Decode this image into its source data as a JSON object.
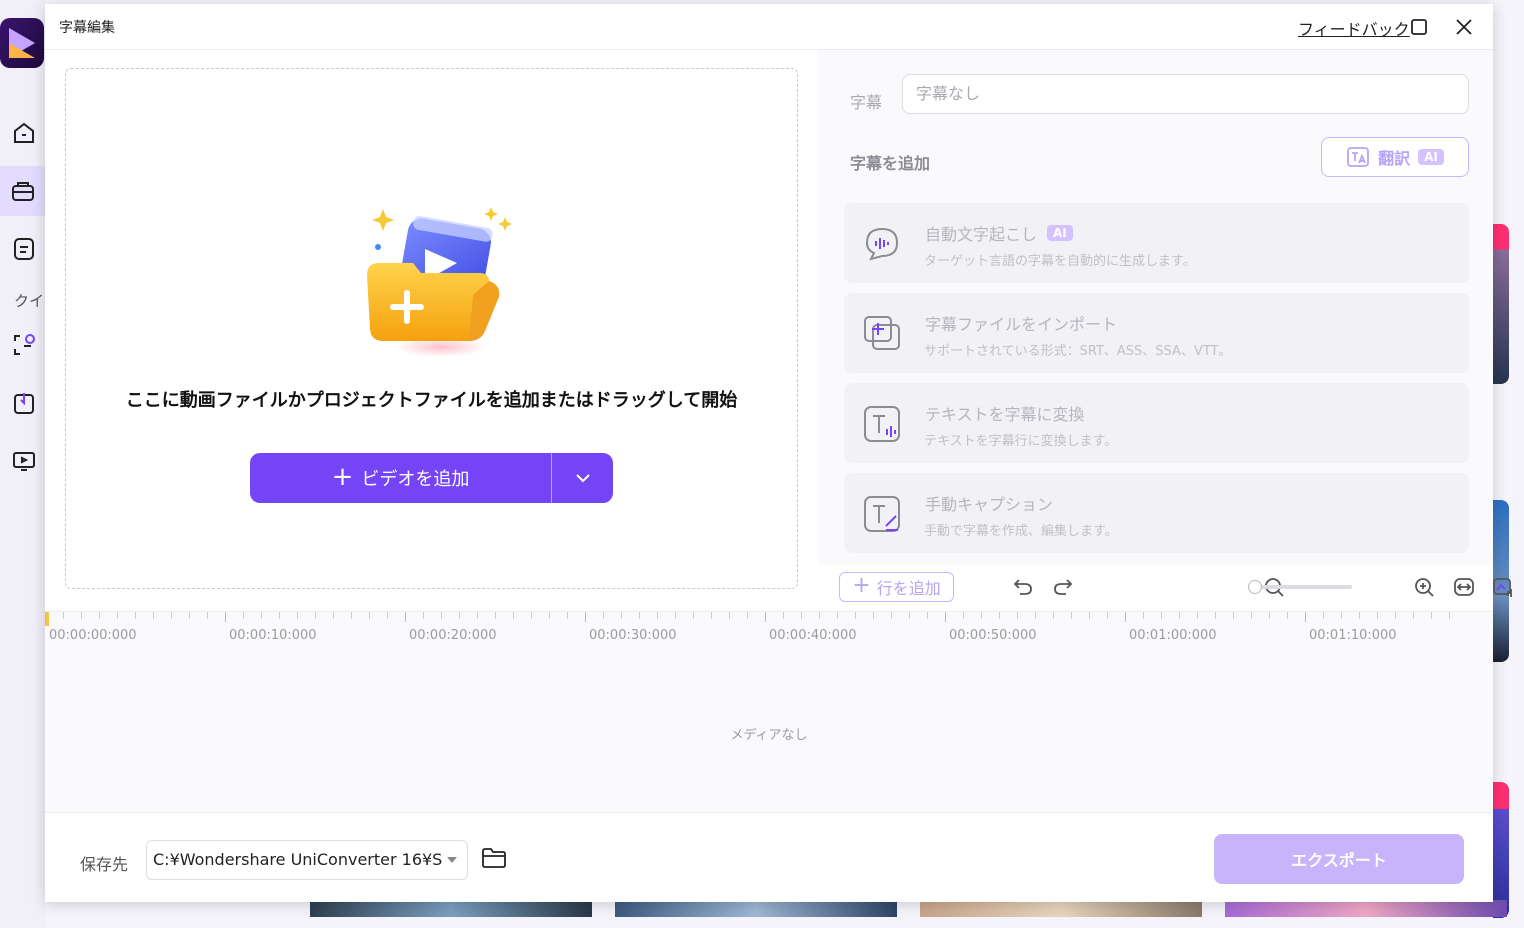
{
  "dialog": {
    "title": "字幕編集",
    "feedback_label": "フィードバック"
  },
  "background": {
    "sidebar_label": "クイ"
  },
  "drop_zone": {
    "instruction": "ここに動画ファイルかプロジェクトファイルを追加またはドラッグして開始",
    "add_video_label": "ビデオを追加"
  },
  "subtitle_panel": {
    "subtitle_label": "字幕",
    "subtitle_value": "字幕なし",
    "add_subtitle_title": "字幕を追加",
    "translate_label": "翻訳",
    "ai_badge": "AI",
    "options": [
      {
        "title": "自動文字起こし",
        "desc": "ターゲット言語の字幕を自動的に生成します。",
        "ai": "AI",
        "icon": "speech-bubble-icon"
      },
      {
        "title": "字幕ファイルをインポート",
        "desc": "サポートされている形式：SRT、ASS、SSA、VTT。",
        "icon": "import-subtitle-icon"
      },
      {
        "title": "テキストを字幕に変換",
        "desc": "テキストを字幕行に変換します。",
        "icon": "text-to-subtitle-icon"
      },
      {
        "title": "手動キャプション",
        "desc": "手動で字幕を作成、編集します。",
        "icon": "manual-caption-icon"
      }
    ]
  },
  "toolbar": {
    "add_line_label": "行を追加",
    "zoom_level": 0
  },
  "timeline": {
    "ticks": [
      "00:00:00:000",
      "00:00:10:000",
      "00:00:20:000",
      "00:00:30:000",
      "00:00:40:000",
      "00:00:50:000",
      "00:01:00:000",
      "00:01:10:000"
    ],
    "empty_label": "メディアなし"
  },
  "footer": {
    "save_label": "保存先",
    "save_path": "C:¥Wondershare UniConverter 16¥S",
    "export_label": "エクスポート"
  },
  "colors": {
    "accent": "#7444f6",
    "accent_disabled": "#c7b4fb"
  }
}
